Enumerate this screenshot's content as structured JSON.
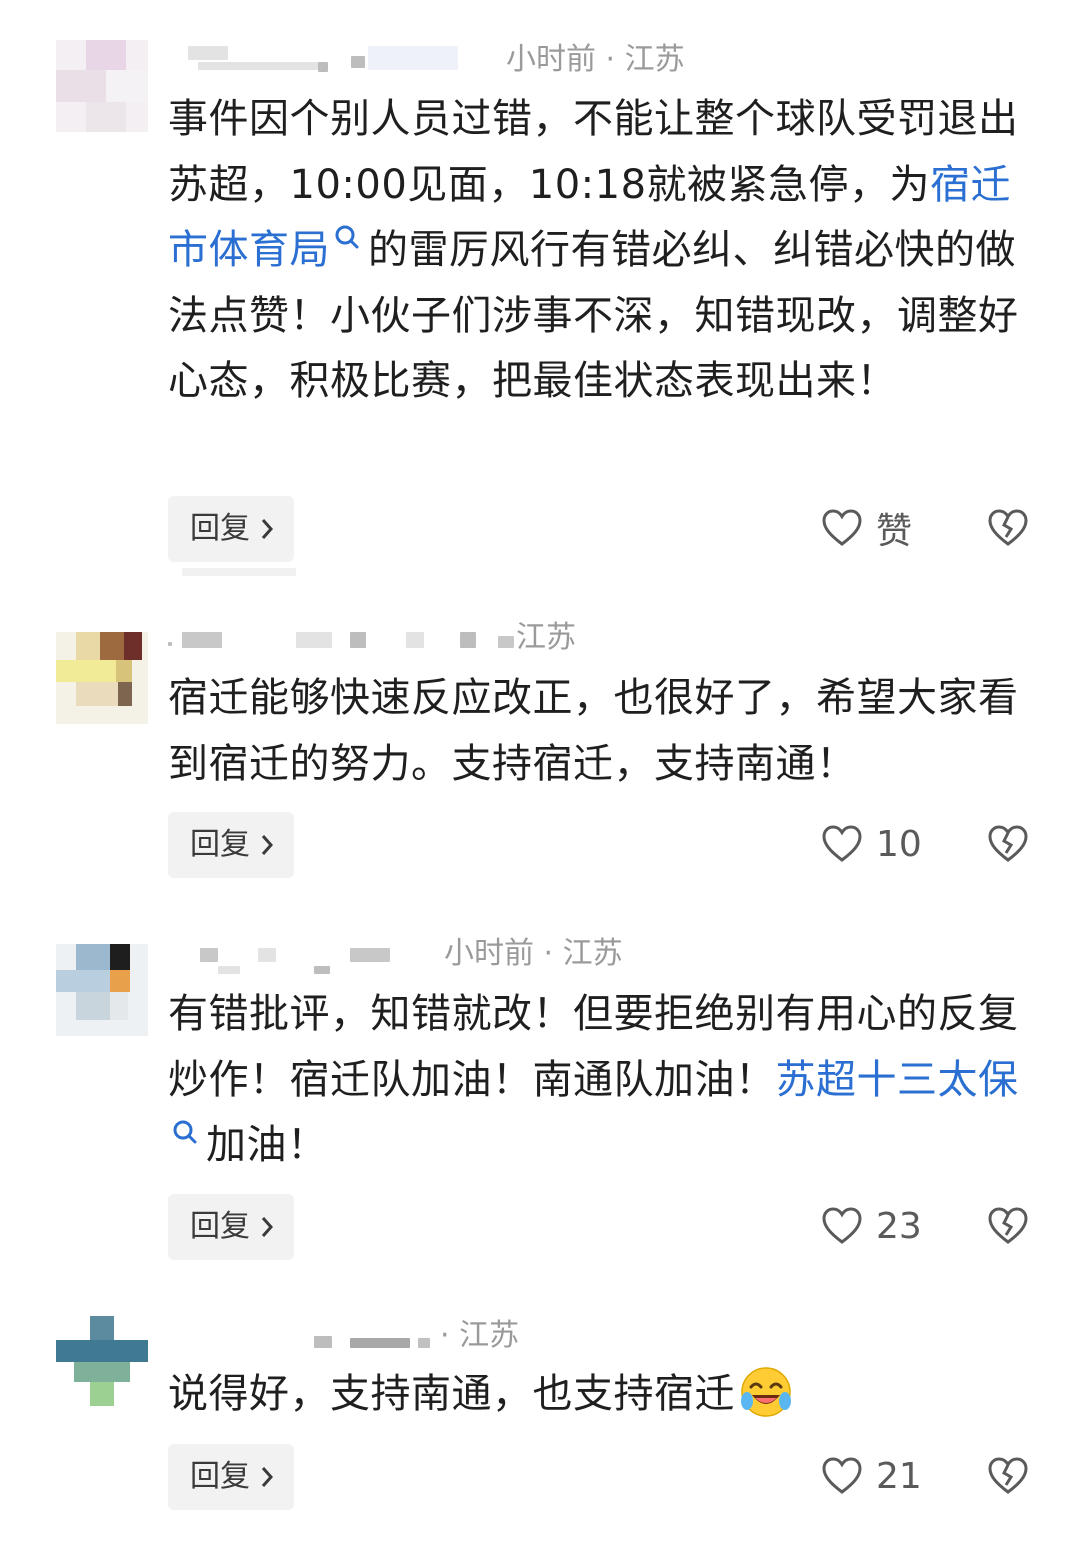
{
  "comments": [
    {
      "meta_time": "小时前 · 江苏",
      "text_parts": [
        "事件因个别人员过错，不能让整个球队受罚退出苏超，10:00见面，10:18就被紧急停，为",
        "宿迁市体育局",
        "的雷厉风行有错必纠、纠错必快的做法点赞！小伙子们涉事不深，知错现改，调整好心态，积极比赛，把最佳状态表现出来！"
      ],
      "reply_label": "回复",
      "like_text": "赞"
    },
    {
      "meta_time": "江苏",
      "text": "宿迁能够快速反应改正，也很好了，希望大家看到宿迁的努力。支持宿迁，支持南通！",
      "reply_label": "回复",
      "like_text": "10"
    },
    {
      "meta_time": "小时前 · 江苏",
      "text_parts": [
        "有错批评，知错就改！但要拒绝别有用心的反复炒作！宿迁队加油！南通队加油！",
        "苏超十三太保",
        "加油！"
      ],
      "reply_label": "回复",
      "like_text": "23"
    },
    {
      "meta_time": "· 江苏",
      "text": "说得好，支持南通，也支持宿迁",
      "reply_label": "回复",
      "like_text": "21"
    }
  ],
  "icons": {
    "reply_chevron": "chevron-right-icon",
    "like": "heart-outline-icon",
    "dislike": "broken-heart-icon",
    "search_link": "search-icon",
    "emoji": "crying-laughing-emoji"
  },
  "colors": {
    "text": "#1f1f1f",
    "meta": "#9a9a9a",
    "link": "#2a6fd1",
    "reply_bg": "#f2f2f2",
    "icon": "#5a5a5a"
  }
}
